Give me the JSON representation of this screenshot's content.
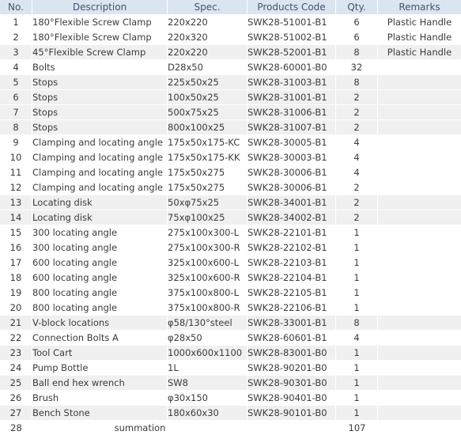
{
  "table": {
    "columns": [
      {
        "key": "no",
        "label": "No."
      },
      {
        "key": "desc",
        "label": "Description"
      },
      {
        "key": "spec",
        "label": "Spec."
      },
      {
        "key": "code",
        "label": "Products Code"
      },
      {
        "key": "qty",
        "label": "Qty."
      },
      {
        "key": "remarks",
        "label": "Remarks"
      }
    ],
    "rows": [
      {
        "no": "1",
        "desc": "180°Flexible Screw Clamp",
        "spec": "220x220",
        "code": "SWK28-51001-B1",
        "qty": "6",
        "remarks": "Plastic Handle",
        "shaded": false
      },
      {
        "no": "2",
        "desc": "180°Flexible Screw Clamp",
        "spec": "220x320",
        "code": "SWK28-51002-B1",
        "qty": "6",
        "remarks": "Plastic Handle",
        "shaded": false
      },
      {
        "no": "3",
        "desc": "45°Flexible Screw Clamp",
        "spec": "220x220",
        "code": "SWK28-52001-B1",
        "qty": "8",
        "remarks": "Plastic Handle",
        "shaded": true
      },
      {
        "no": "4",
        "desc": "Bolts",
        "spec": "D28x50",
        "code": "SWK28-60001-B0",
        "qty": "32",
        "remarks": "",
        "shaded": false
      },
      {
        "no": "5",
        "desc": "Stops",
        "spec": "225x50x25",
        "code": "SWK28-31003-B1",
        "qty": "8",
        "remarks": "",
        "shaded": true
      },
      {
        "no": "6",
        "desc": "Stops",
        "spec": "100x50x25",
        "code": "SWK28-31001-B1",
        "qty": "2",
        "remarks": "",
        "shaded": true
      },
      {
        "no": "7",
        "desc": "Stops",
        "spec": "500x75x25",
        "code": "SWK28-31006-B1",
        "qty": "2",
        "remarks": "",
        "shaded": true
      },
      {
        "no": "8",
        "desc": "Stops",
        "spec": "800x100x25",
        "code": "SWK28-31007-B1",
        "qty": "2",
        "remarks": "",
        "shaded": true
      },
      {
        "no": "9",
        "desc": "Clamping and locating angle",
        "spec": "175x50x175-KC",
        "code": "SWK28-30005-B1",
        "qty": "4",
        "remarks": "",
        "shaded": false
      },
      {
        "no": "10",
        "desc": "Clamping and locating angle",
        "spec": "175x50x175-KK",
        "code": "SWK28-30003-B1",
        "qty": "4",
        "remarks": "",
        "shaded": false
      },
      {
        "no": "11",
        "desc": "Clamping and locating angle",
        "spec": "175x50x275",
        "code": "SWK28-30006-B1",
        "qty": "4",
        "remarks": "",
        "shaded": false
      },
      {
        "no": "12",
        "desc": "Clamping and locating angle",
        "spec": "175x50x275",
        "code": "SWK28-30006-B1",
        "qty": "2",
        "remarks": "",
        "shaded": false
      },
      {
        "no": "13",
        "desc": "Locating disk",
        "spec": "50xφ75x25",
        "code": "SWK28-34001-B1",
        "qty": "2",
        "remarks": "",
        "shaded": true
      },
      {
        "no": "14",
        "desc": "Locating disk",
        "spec": "75xφ100x25",
        "code": "SWK28-34002-B1",
        "qty": "2",
        "remarks": "",
        "shaded": true
      },
      {
        "no": "15",
        "desc": "300 locating angle",
        "spec": "275x100x300-L",
        "code": "SWK28-22101-B1",
        "qty": "1",
        "remarks": "",
        "shaded": false
      },
      {
        "no": "16",
        "desc": "300 locating angle",
        "spec": "275x100x300-R",
        "code": "SWK28-22102-B1",
        "qty": "1",
        "remarks": "",
        "shaded": false
      },
      {
        "no": "17",
        "desc": "600 locating angle",
        "spec": "325x100x600-L",
        "code": "SWK28-22103-B1",
        "qty": "1",
        "remarks": "",
        "shaded": false
      },
      {
        "no": "18",
        "desc": "600 locating angle",
        "spec": "325x100x600-R",
        "code": "SWK28-22104-B1",
        "qty": "1",
        "remarks": "",
        "shaded": false
      },
      {
        "no": "19",
        "desc": "800 locating angle",
        "spec": "375x100x800-L",
        "code": "SWK28-22105-B1",
        "qty": "1",
        "remarks": "",
        "shaded": false
      },
      {
        "no": "20",
        "desc": "800 locating angle",
        "spec": "375x100x800-R",
        "code": "SWK28-22106-B1",
        "qty": "1",
        "remarks": "",
        "shaded": false
      },
      {
        "no": "21",
        "desc": "V-block locations",
        "spec": "φ58/130°steel",
        "code": "SWK28-33001-B1",
        "qty": "8",
        "remarks": "",
        "shaded": true
      },
      {
        "no": "22",
        "desc": "Connection Bolts A",
        "spec": "φ28x50",
        "code": "SWK28-60601-B1",
        "qty": "4",
        "remarks": "",
        "shaded": false
      },
      {
        "no": "23",
        "desc": "Tool Cart",
        "spec": "1000x600x1100",
        "code": "SWK28-83001-B0",
        "qty": "1",
        "remarks": "",
        "shaded": true
      },
      {
        "no": "24",
        "desc": "Pump Bottle",
        "spec": "1L",
        "code": "SWK28-90201-B0",
        "qty": "1",
        "remarks": "",
        "shaded": false
      },
      {
        "no": "25",
        "desc": "Ball end hex wrench",
        "spec": "SW8",
        "code": "SWK28-90301-B0",
        "qty": "1",
        "remarks": "",
        "shaded": true
      },
      {
        "no": "26",
        "desc": "Brush",
        "spec": "φ30x150",
        "code": "SWK28-90401-B0",
        "qty": "1",
        "remarks": "",
        "shaded": false
      },
      {
        "no": "27",
        "desc": "Bench Stone",
        "spec": "180x60x30",
        "code": "SWK28-90101-B0",
        "qty": "1",
        "remarks": "",
        "shaded": true
      }
    ],
    "total_row": {
      "no": "28",
      "label": "summation",
      "qty": "107"
    }
  },
  "colors": {
    "header_background": "#dbe5f1",
    "header_text": "#44546a",
    "row_shaded": "#f0f0f0",
    "row_plain": "#ffffff",
    "body_text": "#3b3b3b",
    "separator": "#ffffff"
  }
}
